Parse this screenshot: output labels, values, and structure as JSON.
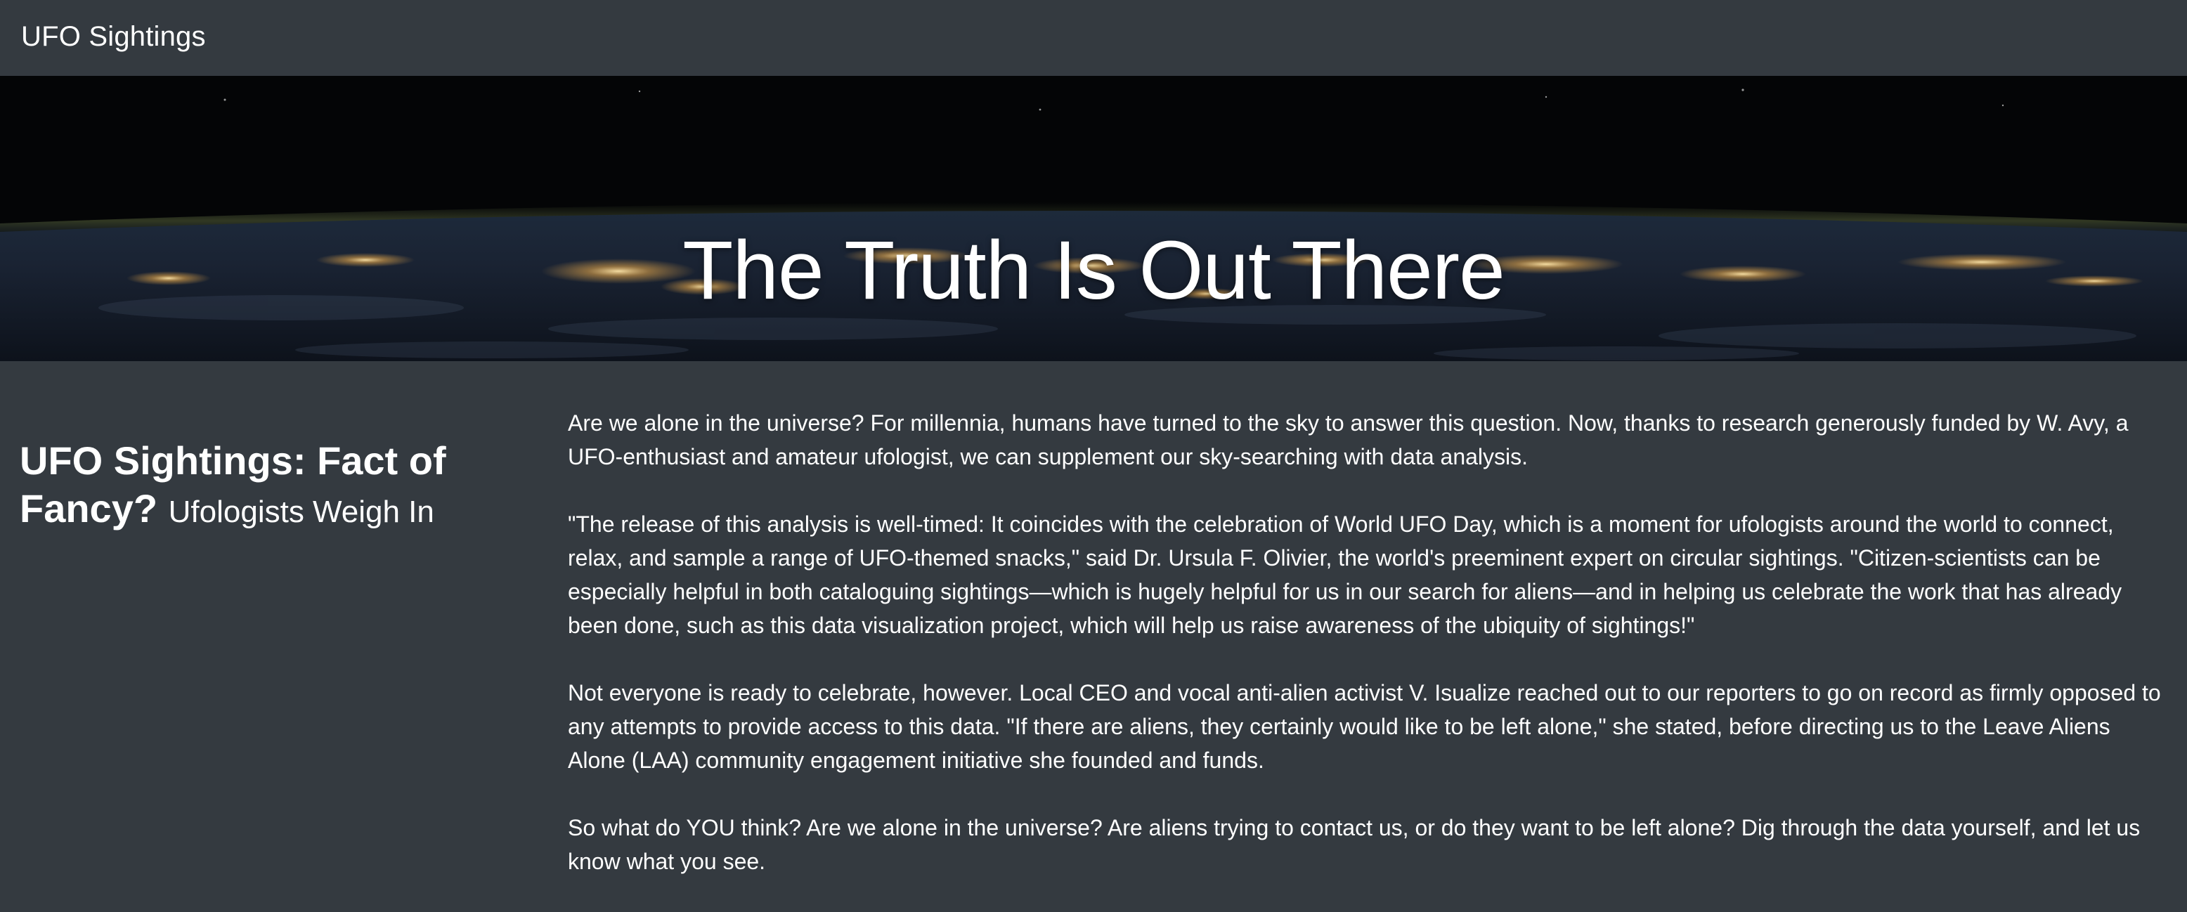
{
  "navbar": {
    "brand": "UFO Sightings"
  },
  "hero": {
    "title": "The Truth Is Out There",
    "background": "earth-at-night-from-orbit"
  },
  "sidebar": {
    "heading": "UFO Sightings: Fact of Fancy?",
    "subheading": "Ufologists Weigh In"
  },
  "article": {
    "paragraphs": [
      "Are we alone in the universe? For millennia, humans have turned to the sky to answer this question. Now, thanks to research generously funded by W. Avy, a UFO-enthusiast and amateur ufologist, we can supplement our sky-searching with data analysis.",
      "\"The release of this analysis is well-timed: It coincides with the celebration of World UFO Day, which is a moment for ufologists around the world to connect, relax, and sample a range of UFO-themed snacks,\" said Dr. Ursula F. Olivier, the world's preeminent expert on circular sightings. \"Citizen-scientists can be especially helpful in both cataloguing sightings—which is hugely helpful for us in our search for aliens—and in helping us celebrate the work that has already been done, such as this data visualization project, which will help us raise awareness of the ubiquity of sightings!\"",
      "Not everyone is ready to celebrate, however. Local CEO and vocal anti-alien activist V. Isualize reached out to our reporters to go on record as firmly opposed to any attempts to provide access to this data. \"If there are aliens, they certainly would like to be left alone,\" she stated, before directing us to the Leave Aliens Alone (LAA) community engagement initiative she founded and funds.",
      "So what do YOU think? Are we alone in the universe? Are aliens trying to contact us, or do they want to be left alone? Dig through the data yourself, and let us know what you see."
    ]
  },
  "colors": {
    "page_background": "#343a40",
    "text": "#ffffff"
  }
}
